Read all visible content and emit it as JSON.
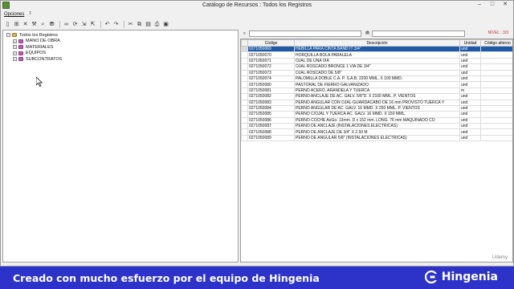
{
  "window": {
    "title": "Catálogo de Recursos  :  Todos los Registros",
    "controls": [
      "–",
      "□",
      "✕"
    ]
  },
  "menubar": {
    "items": [
      {
        "label": "Opciones"
      }
    ],
    "pin": "⤒"
  },
  "toolbar": {
    "buttons": [
      "new-icon",
      "add-icon",
      "delete-icon",
      "tools-icon",
      "find-icon",
      "filter-icon",
      "binoculars-icon",
      "refresh-icon",
      "export-icon",
      "undo-icon",
      "redo-icon",
      "cut-icon",
      "copy-icon",
      "paste-icon",
      "print-icon",
      "preview-icon"
    ]
  },
  "tree": {
    "root": "Todos los Registros",
    "children": [
      {
        "label": "MANO DE OBRA"
      },
      {
        "label": "MATERIALES"
      },
      {
        "label": "EQUIPOS"
      },
      {
        "label": "SUBCONTRATOS"
      }
    ]
  },
  "grid_header": {
    "nivel": "NIVEL : 3/3"
  },
  "table": {
    "columns": [
      "Código",
      "Descripción",
      "Unidad",
      "Código alterno"
    ],
    "rows": [
      {
        "codigo": "0271050069",
        "descripcion": "HEBILLA PARA CINTA BAND IT 3/4\"",
        "unidad": "und",
        "alterno": "",
        "selected": true
      },
      {
        "codigo": "0271050070",
        "descripcion": "HORQUILLA BOLA PARALELA",
        "unidad": "und",
        "alterno": ""
      },
      {
        "codigo": "0271050071",
        "descripcion": "OJAL DE UNA VIA",
        "unidad": "und",
        "alterno": ""
      },
      {
        "codigo": "0271050072",
        "descripcion": "OJAL ROSCADO BRONCE 1 VIA DE 3/4\"",
        "unidad": "und",
        "alterno": ""
      },
      {
        "codigo": "0271050073",
        "descripcion": "OJAL ROSCADO DE 5/8\"",
        "unidad": "und",
        "alterno": ""
      },
      {
        "codigo": "0271050074",
        "descripcion": "PALOMILLA DOBLE C.A. P. S.A.B. 2200 MML. X 100 MMD.",
        "unidad": "und",
        "alterno": ""
      },
      {
        "codigo": "0271050080",
        "descripcion": "PASTORAL DE FIERRO GALVANIZADO",
        "unidad": "und",
        "alterno": ""
      },
      {
        "codigo": "0271050081",
        "descripcion": "PERNO ACERO, ARANDELA Y TUERCA",
        "unidad": "m",
        "alterno": ""
      },
      {
        "codigo": "0271050082",
        "descripcion": "PERNO ANCLAJE DE AC. GALV. 5/8\"D. X 2100 MML. P. VIENTOS",
        "unidad": "und",
        "alterno": ""
      },
      {
        "codigo": "0271050083",
        "descripcion": "PERNO ANGULAR CON OJAL-GUARDACABO DE 16 mm PROVISTO TUERCA Y",
        "unidad": "und",
        "alterno": ""
      },
      {
        "codigo": "0271050084",
        "descripcion": "PERNO ANGULAR DE AC. GALV. 16 MMD. X 250 MML. P. VIENTOS",
        "unidad": "und",
        "alterno": ""
      },
      {
        "codigo": "0271050085",
        "descripcion": "PERNO C/OJAL Y TUERCA AC. GALV. 16 MMD. X 150 MML.",
        "unidad": "und",
        "alterno": ""
      },
      {
        "codigo": "0271050086",
        "descripcion": "PERNO COCHE AoGo. 13mm. D x 152 mm. LONG. 76 mm MAQUINADO CO",
        "unidad": "und",
        "alterno": ""
      },
      {
        "codigo": "0271050087",
        "descripcion": "PERNO DE ANCLAJE (INSTALACIONES ELECTRICAS)",
        "unidad": "und",
        "alterno": ""
      },
      {
        "codigo": "0271050088",
        "descripcion": "PERNO DE ANCLAJE DE 3/4\" X 2.50 M",
        "unidad": "und",
        "alterno": ""
      },
      {
        "codigo": "0271050089",
        "descripcion": "PERNO DE ANGULAR 5/8\" (INSTALACIONES ELECTRICAS)",
        "unidad": "und",
        "alterno": ""
      }
    ]
  },
  "banner": {
    "text": "Creado con mucho esfuerzo por el equipo de Hingenia",
    "brand": "Hingenia",
    "color": "#2d33c9"
  },
  "watermark": "Udemy"
}
